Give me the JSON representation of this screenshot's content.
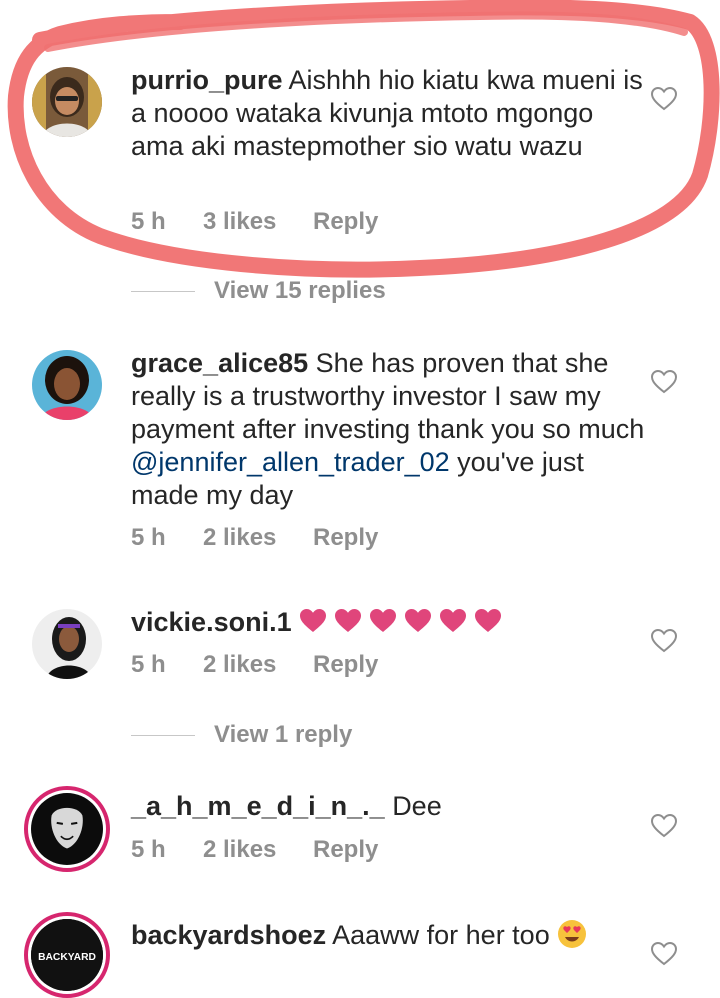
{
  "comments": [
    {
      "username": "purrio_pure",
      "text": "Aishhh hio kiatu kwa mueni is a noooo wataka kivunja mtoto mgongo ama aki mastepmother sio watu wazu",
      "time": "5 h",
      "likes": "3 likes",
      "reply": "Reply",
      "view_replies": "View 15 replies"
    },
    {
      "username": "grace_alice85",
      "text_before": "She has proven that she really is a trustworthy investor I saw my payment after  investing thank you so much ",
      "mention": "@jennifer_allen_trader_02",
      "text_after": "  you've just made my day",
      "time": "5 h",
      "likes": "2 likes",
      "reply": "Reply"
    },
    {
      "username": "vickie.soni.1",
      "emoji_icon": "pink-heart-icon",
      "emoji_count": 6,
      "time": "5 h",
      "likes": "2 likes",
      "reply": "Reply",
      "view_replies": "View 1 reply"
    },
    {
      "username": "_a_h_m_e_d_i_n_._",
      "text": "Dee",
      "time": "5 h",
      "likes": "2 likes",
      "reply": "Reply"
    },
    {
      "username": "backyardshoez",
      "text": "Aaaww for her too",
      "emoji_icon": "heart-eyes-face-icon",
      "avatar_text": "BACKYARD"
    }
  ],
  "colors": {
    "meta_gray": "#8e8e8e",
    "text": "#262626",
    "mention": "#00376b",
    "highlight": "#f07070",
    "heart_emoji": "#e0457b",
    "story_ring": "#d6266e"
  }
}
